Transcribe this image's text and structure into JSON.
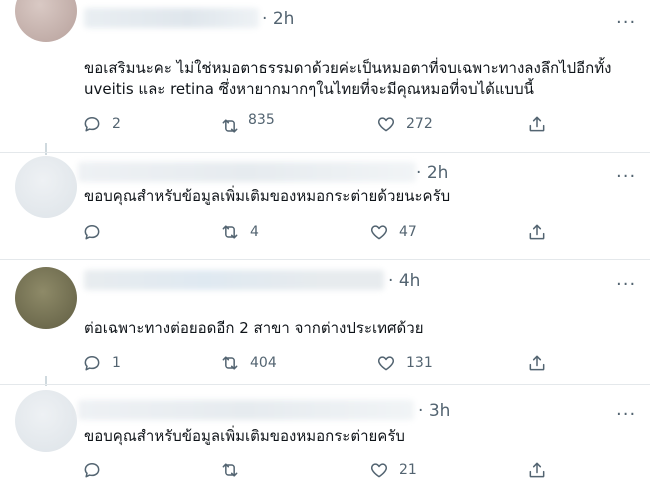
{
  "tweets": [
    {
      "time": "2h",
      "text_lines": [
        "ขอเสริมนะคะ ไม่ใช่หมอตาธรรมดาด้วยค่ะเป็นหมอตาที่จบเฉพาะทางลงลึกไปอีกทั้ง",
        "uveitis และ retina ซึ่งหายากมากๆในไทยที่จะมีคุณหมอที่จบได้แบบนี้"
      ],
      "reply_count": "2",
      "retweet_count": "835",
      "like_count": "272"
    },
    {
      "time": "2h",
      "text_lines": [
        "ขอบคุณสำหรับข้อมูลเพิ่มเติมของหมอกระต่ายด้วยนะครับ"
      ],
      "reply_count": "",
      "retweet_count": "4",
      "like_count": "47"
    },
    {
      "time": "4h",
      "text_lines": [
        "ต่อเฉพาะทางต่อยอดอีก 2 สาขา จากต่างประเทศด้วย"
      ],
      "reply_count": "1",
      "retweet_count": "404",
      "like_count": "131"
    },
    {
      "time": "3h",
      "text_lines": [
        "ขอบคุณสำหรับข้อมูลเพิ่มเติมของหมอกระต่ายครับ"
      ],
      "reply_count": "",
      "retweet_count": "",
      "like_count": "21"
    }
  ],
  "icons": {
    "more": "more-horizontal-icon",
    "reply": "reply-bubble-icon",
    "retweet": "retweet-arrows-icon",
    "like": "heart-icon",
    "share": "share-upload-icon"
  },
  "colors": {
    "text": "#0f1419",
    "muted": "#536471",
    "divider": "#e4e8eb",
    "thread_line": "#cfd9de"
  }
}
